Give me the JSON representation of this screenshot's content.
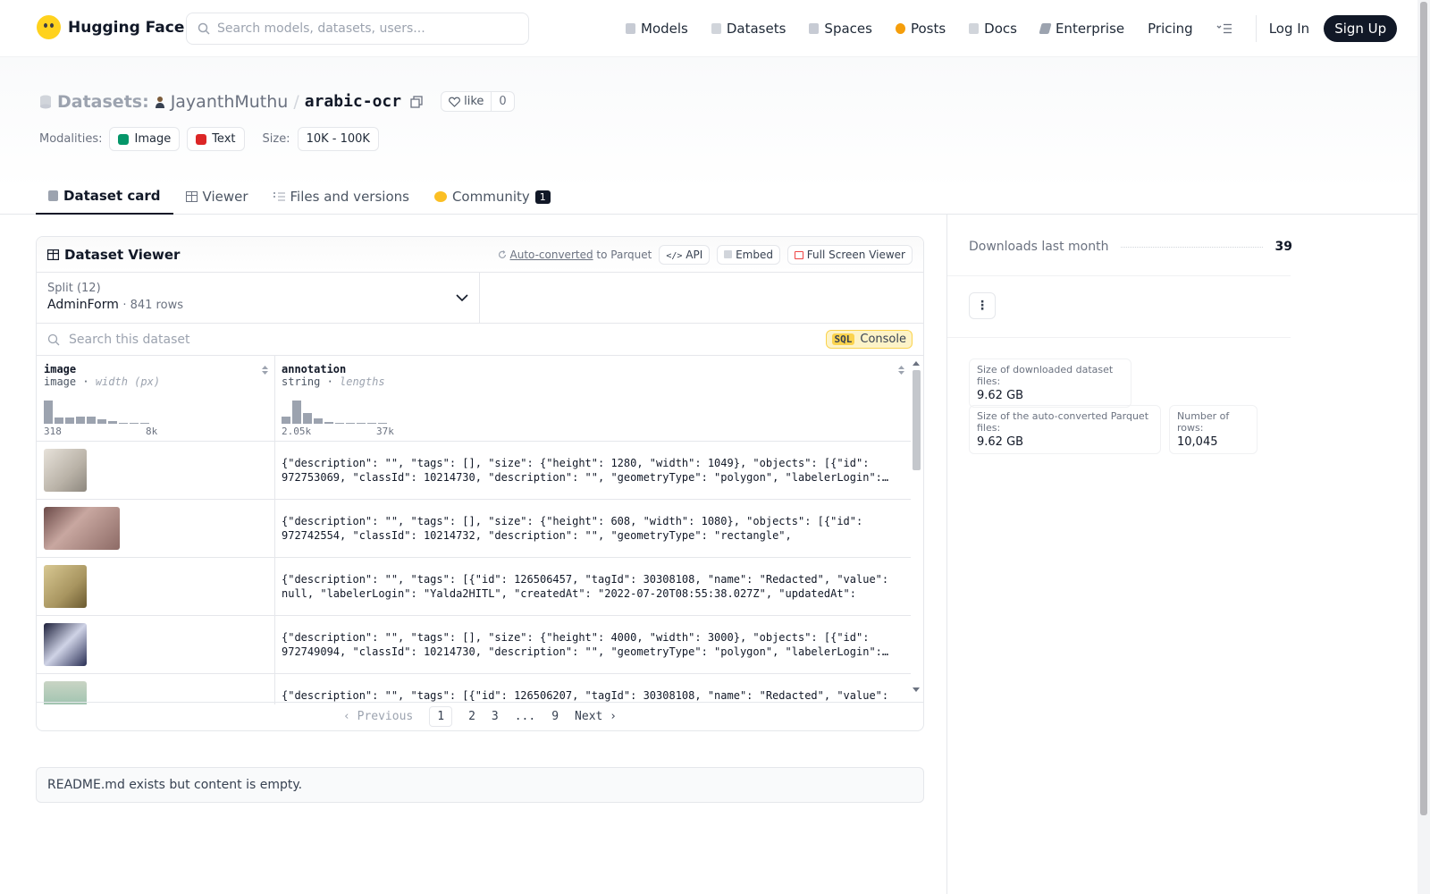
{
  "nav": {
    "brand": "Hugging Face",
    "search_placeholder": "Search models, datasets, users...",
    "links": [
      "Models",
      "Datasets",
      "Spaces",
      "Posts",
      "Docs",
      "Enterprise",
      "Pricing"
    ],
    "login": "Log In",
    "signup": "Sign Up"
  },
  "header": {
    "section": "Datasets:",
    "user": "JayanthMuthu",
    "repo": "arabic-ocr",
    "like_label": "like",
    "like_count": "0",
    "modalities_label": "Modalities:",
    "modalities": [
      "Image",
      "Text"
    ],
    "size_label": "Size:",
    "size_value": "10K - 100K",
    "tabs": [
      "Dataset card",
      "Viewer",
      "Files and versions",
      "Community"
    ],
    "community_count": "1"
  },
  "viewer": {
    "title": "Dataset Viewer",
    "auto_converted": "Auto-converted",
    "to_parquet": "to Parquet",
    "api": "API",
    "embed": "Embed",
    "fullscreen": "Full Screen Viewer",
    "split_label": "Split (12)",
    "split_value": "AdminForm",
    "split_rows": "841 rows",
    "search_placeholder": "Search this dataset",
    "sql": "SQL",
    "console": "Console",
    "columns": [
      {
        "name": "image",
        "type": "image",
        "stat": "width (px)",
        "min": "318",
        "max": "8k"
      },
      {
        "name": "annotation",
        "type": "string",
        "stat": "lengths",
        "min": "2.05k",
        "max": "37k"
      }
    ],
    "rows": [
      "{\"description\": \"\", \"tags\": [], \"size\": {\"height\": 1280, \"width\": 1049}, \"objects\": [{\"id\": 972753069, \"classId\": 10214730, \"description\": \"\", \"geometryType\": \"polygon\", \"labelerLogin\":…",
      "{\"description\": \"\", \"tags\": [], \"size\": {\"height\": 608, \"width\": 1080}, \"objects\": [{\"id\": 972742554, \"classId\": 10214732, \"description\": \"\", \"geometryType\": \"rectangle\", \"labelerLogin\":…",
      "{\"description\": \"\", \"tags\": [{\"id\": 126506457, \"tagId\": 30308108, \"name\": \"Redacted\", \"value\": null, \"labelerLogin\": \"Yalda2HITL\", \"createdAt\": \"2022-07-20T08:55:38.027Z\", \"updatedAt\": \"2022-…",
      "{\"description\": \"\", \"tags\": [], \"size\": {\"height\": 4000, \"width\": 3000}, \"objects\": [{\"id\": 972749094, \"classId\": 10214730, \"description\": \"\", \"geometryType\": \"polygon\", \"labelerLogin\":…",
      "{\"description\": \"\", \"tags\": [{\"id\": 126506207, \"tagId\": 30308108, \"name\": \"Redacted\", \"value\":"
    ],
    "pager": {
      "prev": "Previous",
      "pages": [
        "1",
        "2",
        "3",
        "...",
        "9"
      ],
      "next": "Next"
    }
  },
  "readme": "README.md exists but content is empty.",
  "sidebar": {
    "downloads_label": "Downloads last month",
    "downloads": "39",
    "more": "⋮",
    "dl_size_label": "Size of downloaded dataset files:",
    "dl_size": "9.62 GB",
    "parquet_size_label": "Size of the auto-converted Parquet files:",
    "parquet_size": "9.62 GB",
    "rows_label": "Number of rows:",
    "rows": "10,045"
  }
}
